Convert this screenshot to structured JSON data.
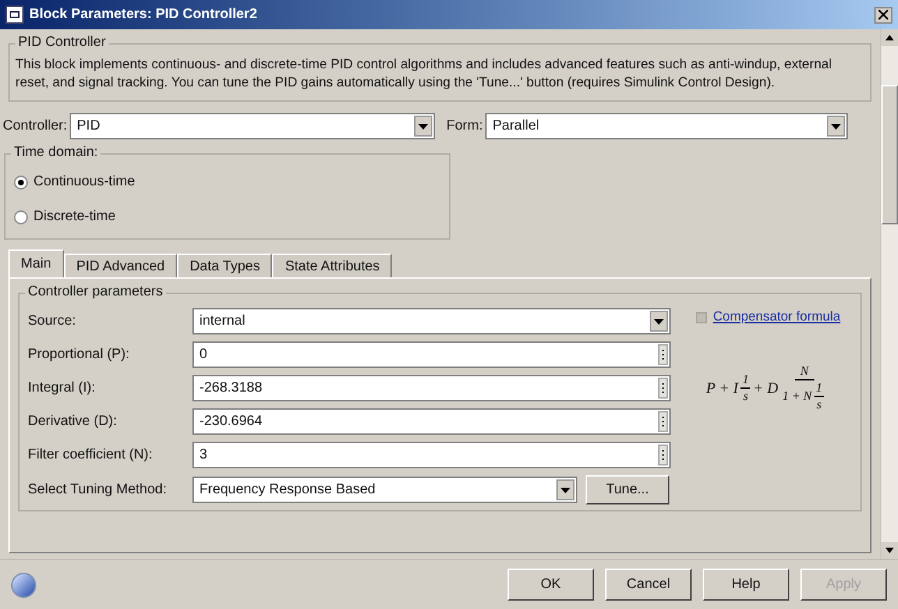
{
  "window": {
    "title": "Block Parameters: PID Controller2"
  },
  "group": {
    "title": "PID Controller",
    "description": "This block implements continuous- and discrete-time PID control algorithms and includes advanced features such as anti-windup, external reset, and signal tracking. You can tune the PID gains automatically using the 'Tune...' button (requires Simulink Control Design)."
  },
  "controller": {
    "label": "Controller:",
    "value": "PID"
  },
  "form": {
    "label": "Form:",
    "value": "Parallel"
  },
  "time_domain": {
    "title": "Time domain:",
    "options": [
      {
        "label": "Continuous-time",
        "selected": true
      },
      {
        "label": "Discrete-time",
        "selected": false
      }
    ]
  },
  "tabs": [
    {
      "label": "Main",
      "selected": true
    },
    {
      "label": "PID Advanced",
      "selected": false
    },
    {
      "label": "Data Types",
      "selected": false
    },
    {
      "label": "State Attributes",
      "selected": false
    }
  ],
  "parameters": {
    "title": "Controller parameters",
    "rows": [
      {
        "kind": "dropdown",
        "label": "Source:",
        "value": "internal"
      },
      {
        "kind": "edit",
        "label": "Proportional (P):",
        "value": "0"
      },
      {
        "kind": "edit",
        "label": "Integral (I):",
        "value": "-268.3188"
      },
      {
        "kind": "edit",
        "label": "Derivative (D):",
        "value": "-230.6964"
      },
      {
        "kind": "edit",
        "label": "Filter coefficient (N):",
        "value": "3"
      }
    ],
    "tuning": {
      "label": "Select Tuning Method:",
      "value": "Frequency Response Based",
      "button": "Tune..."
    },
    "compensator_link": "Compensator formula",
    "formula": {
      "lead": "P + I",
      "f1_num": "1",
      "f1_den": "s",
      "mid": "+ D",
      "f2_num": "N",
      "f2_den": "1 + N",
      "f3_num": "1",
      "f3_den": "s"
    }
  },
  "buttons": [
    {
      "label": "OK",
      "disabled": false
    },
    {
      "label": "Cancel",
      "disabled": false
    },
    {
      "label": "Help",
      "disabled": false
    },
    {
      "label": "Apply",
      "disabled": true
    }
  ]
}
